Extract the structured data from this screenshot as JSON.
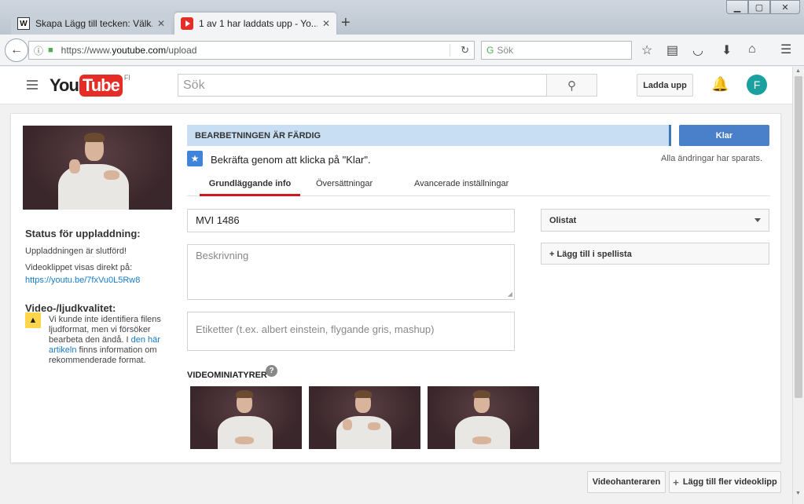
{
  "browser": {
    "tabs": [
      {
        "label": "Skapa Lägg till tecken: Välk...",
        "favicon": "wiki-icon",
        "active": false
      },
      {
        "label": "1 av 1 har laddats upp - Yo...",
        "favicon": "youtube-icon",
        "active": true
      }
    ],
    "new_tab": "+",
    "url_prefix": "https://www.",
    "url_domain": "youtube.com",
    "url_path": "/upload",
    "search_placeholder": "Sök"
  },
  "header": {
    "logo_you": "You",
    "logo_tube": "Tube",
    "logo_region": "FI",
    "search_placeholder": "Sök",
    "upload_label": "Ladda upp",
    "avatar_letter": "F"
  },
  "status": {
    "heading": "Status för uppladdning:",
    "complete": "Uppladdningen är slutförd!",
    "direct_link_label": "Videoklippet visas direkt på:",
    "direct_link": "https://youtu.be/7fxVu0L5Rw8"
  },
  "quality": {
    "heading": "Video-/ljudkvalitet:",
    "warning_pre": "Vi kunde inte identifiera filens ljudformat, men vi försöker bearbeta den ändå. I ",
    "warning_link": "den här artikeln",
    "warning_post": " finns information om rekommenderade format."
  },
  "processing": {
    "label": "BEARBETNINGEN ÄR FÄRDIG",
    "done_button": "Klar",
    "confirm_text": "Bekräfta genom att klicka på \"Klar\".",
    "saved_text": "Alla ändringar har sparats."
  },
  "tabs": [
    {
      "label": "Grundläggande info",
      "active": true
    },
    {
      "label": "Översättningar",
      "active": false
    },
    {
      "label": "Avancerade inställningar",
      "active": false
    }
  ],
  "form": {
    "title_value": "MVI 1486",
    "description_placeholder": "Beskrivning",
    "tags_placeholder": "Etiketter (t.ex. albert einstein, flygande gris, mashup)",
    "privacy_value": "Olistat",
    "playlist_label": "+ Lägg till i spellista"
  },
  "thumbnails": {
    "label": "VIDEOMINIATYRER",
    "help": "?"
  },
  "footer": {
    "video_manager": "Videohanteraren",
    "add_more": "Lägg till fler videoklipp"
  },
  "colors": {
    "accent_red": "#cc181e",
    "done_blue": "#4a7fc9",
    "progress_bg": "#c8dff3"
  }
}
